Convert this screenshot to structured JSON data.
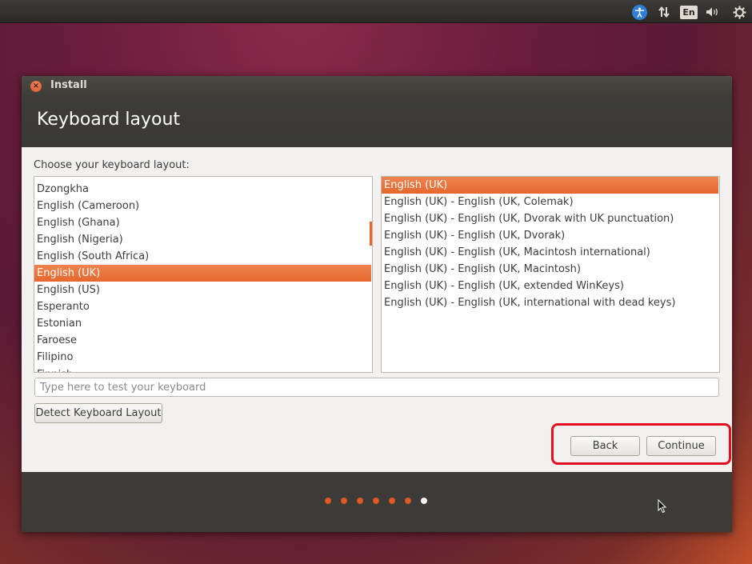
{
  "top_panel": {
    "language_indicator": "En",
    "icons": [
      "accessibility-icon",
      "network-icon",
      "keyboard-language-icon",
      "volume-icon",
      "gear-icon"
    ]
  },
  "window": {
    "title": "Install",
    "heading": "Keyboard layout",
    "choose_label": "Choose your keyboard layout:",
    "layouts": [
      {
        "label": "Dzongkha",
        "selected": false
      },
      {
        "label": "English (Cameroon)",
        "selected": false
      },
      {
        "label": "English (Ghana)",
        "selected": false
      },
      {
        "label": "English (Nigeria)",
        "selected": false
      },
      {
        "label": "English (South Africa)",
        "selected": false
      },
      {
        "label": "English (UK)",
        "selected": true
      },
      {
        "label": "English (US)",
        "selected": false
      },
      {
        "label": "Esperanto",
        "selected": false
      },
      {
        "label": "Estonian",
        "selected": false
      },
      {
        "label": "Faroese",
        "selected": false
      },
      {
        "label": "Filipino",
        "selected": false
      }
    ],
    "variants": [
      {
        "label": "English (UK)",
        "selected": true
      },
      {
        "label": "English (UK) - English (UK, Colemak)",
        "selected": false
      },
      {
        "label": "English (UK) - English (UK, Dvorak with UK punctuation)",
        "selected": false
      },
      {
        "label": "English (UK) - English (UK, Dvorak)",
        "selected": false
      },
      {
        "label": "English (UK) - English (UK, Macintosh international)",
        "selected": false
      },
      {
        "label": "English (UK) - English (UK, Macintosh)",
        "selected": false
      },
      {
        "label": "English (UK) - English (UK, extended WinKeys)",
        "selected": false
      },
      {
        "label": "English (UK) - English (UK, international with dead keys)",
        "selected": false
      }
    ],
    "test_input": {
      "placeholder": "Type here to test your keyboard",
      "value": ""
    },
    "detect_button": "Detect Keyboard Layout",
    "back_button": "Back",
    "continue_button": "Continue"
  },
  "progress": {
    "total_steps": 7,
    "current_step": 7
  },
  "colors": {
    "accent": "#e5672e",
    "highlight_box": "#e01020",
    "panel": "#3c3b37"
  }
}
